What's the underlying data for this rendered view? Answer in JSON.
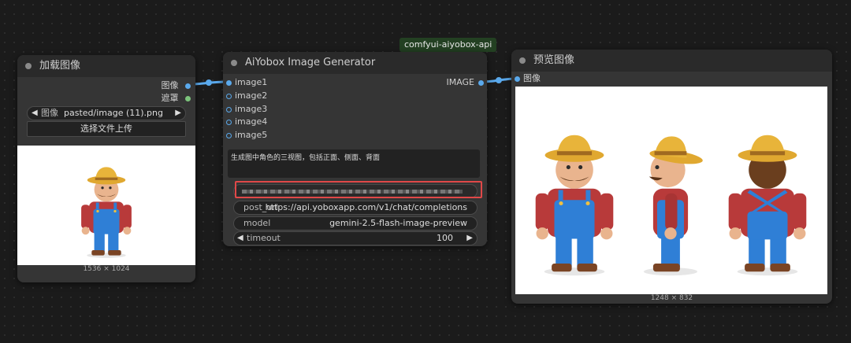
{
  "group_tag": "comfyui-aiyobox-api",
  "load_node": {
    "title": "加载图像",
    "outputs": [
      "图像",
      "遮罩"
    ],
    "image_widget": {
      "label": "图像",
      "value": "pasted/image (11).png"
    },
    "upload_button": "选择文件上传",
    "dimensions": "1536 × 1024"
  },
  "gen_node": {
    "title": "AiYobox Image Generator",
    "inputs": [
      "image1",
      "image2",
      "image3",
      "image4",
      "image5"
    ],
    "output": "IMAGE",
    "prompt": "生成图中角色的三视图，包括正面、侧面、背面",
    "post_url": {
      "label": "post_url",
      "value": "https://api.yoboxapp.com/v1/chat/completions"
    },
    "model": {
      "label": "model",
      "value": "gemini-2.5-flash-image-preview"
    },
    "timeout": {
      "label": "timeout",
      "value": "100"
    }
  },
  "preview_node": {
    "title": "预览图像",
    "input": "图像",
    "dimensions": "1248 × 832"
  },
  "colors": {
    "link": "#5aa9ec",
    "highlight": "#e04848",
    "tag_bg": "#234022"
  }
}
